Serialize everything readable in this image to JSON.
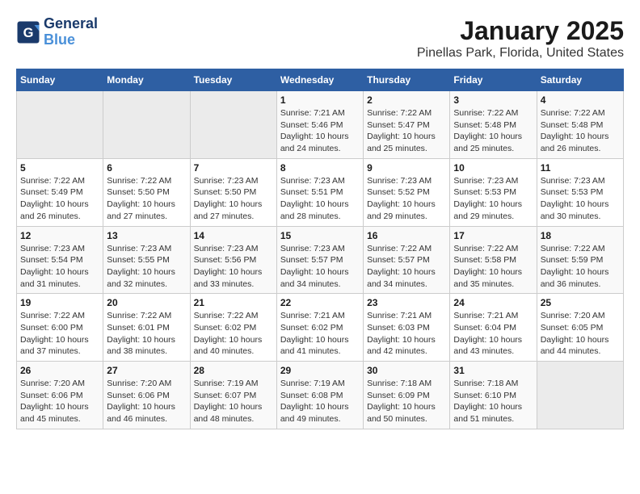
{
  "header": {
    "logo": {
      "general": "General",
      "blue": "Blue"
    },
    "title": "January 2025",
    "subtitle": "Pinellas Park, Florida, United States"
  },
  "calendar": {
    "weekdays": [
      "Sunday",
      "Monday",
      "Tuesday",
      "Wednesday",
      "Thursday",
      "Friday",
      "Saturday"
    ],
    "weeks": [
      [
        {
          "day": "",
          "info": ""
        },
        {
          "day": "",
          "info": ""
        },
        {
          "day": "",
          "info": ""
        },
        {
          "day": "1",
          "info": "Sunrise: 7:21 AM\nSunset: 5:46 PM\nDaylight: 10 hours\nand 24 minutes."
        },
        {
          "day": "2",
          "info": "Sunrise: 7:22 AM\nSunset: 5:47 PM\nDaylight: 10 hours\nand 25 minutes."
        },
        {
          "day": "3",
          "info": "Sunrise: 7:22 AM\nSunset: 5:48 PM\nDaylight: 10 hours\nand 25 minutes."
        },
        {
          "day": "4",
          "info": "Sunrise: 7:22 AM\nSunset: 5:48 PM\nDaylight: 10 hours\nand 26 minutes."
        }
      ],
      [
        {
          "day": "5",
          "info": "Sunrise: 7:22 AM\nSunset: 5:49 PM\nDaylight: 10 hours\nand 26 minutes."
        },
        {
          "day": "6",
          "info": "Sunrise: 7:22 AM\nSunset: 5:50 PM\nDaylight: 10 hours\nand 27 minutes."
        },
        {
          "day": "7",
          "info": "Sunrise: 7:23 AM\nSunset: 5:50 PM\nDaylight: 10 hours\nand 27 minutes."
        },
        {
          "day": "8",
          "info": "Sunrise: 7:23 AM\nSunset: 5:51 PM\nDaylight: 10 hours\nand 28 minutes."
        },
        {
          "day": "9",
          "info": "Sunrise: 7:23 AM\nSunset: 5:52 PM\nDaylight: 10 hours\nand 29 minutes."
        },
        {
          "day": "10",
          "info": "Sunrise: 7:23 AM\nSunset: 5:53 PM\nDaylight: 10 hours\nand 29 minutes."
        },
        {
          "day": "11",
          "info": "Sunrise: 7:23 AM\nSunset: 5:53 PM\nDaylight: 10 hours\nand 30 minutes."
        }
      ],
      [
        {
          "day": "12",
          "info": "Sunrise: 7:23 AM\nSunset: 5:54 PM\nDaylight: 10 hours\nand 31 minutes."
        },
        {
          "day": "13",
          "info": "Sunrise: 7:23 AM\nSunset: 5:55 PM\nDaylight: 10 hours\nand 32 minutes."
        },
        {
          "day": "14",
          "info": "Sunrise: 7:23 AM\nSunset: 5:56 PM\nDaylight: 10 hours\nand 33 minutes."
        },
        {
          "day": "15",
          "info": "Sunrise: 7:23 AM\nSunset: 5:57 PM\nDaylight: 10 hours\nand 34 minutes."
        },
        {
          "day": "16",
          "info": "Sunrise: 7:22 AM\nSunset: 5:57 PM\nDaylight: 10 hours\nand 34 minutes."
        },
        {
          "day": "17",
          "info": "Sunrise: 7:22 AM\nSunset: 5:58 PM\nDaylight: 10 hours\nand 35 minutes."
        },
        {
          "day": "18",
          "info": "Sunrise: 7:22 AM\nSunset: 5:59 PM\nDaylight: 10 hours\nand 36 minutes."
        }
      ],
      [
        {
          "day": "19",
          "info": "Sunrise: 7:22 AM\nSunset: 6:00 PM\nDaylight: 10 hours\nand 37 minutes."
        },
        {
          "day": "20",
          "info": "Sunrise: 7:22 AM\nSunset: 6:01 PM\nDaylight: 10 hours\nand 38 minutes."
        },
        {
          "day": "21",
          "info": "Sunrise: 7:22 AM\nSunset: 6:02 PM\nDaylight: 10 hours\nand 40 minutes."
        },
        {
          "day": "22",
          "info": "Sunrise: 7:21 AM\nSunset: 6:02 PM\nDaylight: 10 hours\nand 41 minutes."
        },
        {
          "day": "23",
          "info": "Sunrise: 7:21 AM\nSunset: 6:03 PM\nDaylight: 10 hours\nand 42 minutes."
        },
        {
          "day": "24",
          "info": "Sunrise: 7:21 AM\nSunset: 6:04 PM\nDaylight: 10 hours\nand 43 minutes."
        },
        {
          "day": "25",
          "info": "Sunrise: 7:20 AM\nSunset: 6:05 PM\nDaylight: 10 hours\nand 44 minutes."
        }
      ],
      [
        {
          "day": "26",
          "info": "Sunrise: 7:20 AM\nSunset: 6:06 PM\nDaylight: 10 hours\nand 45 minutes."
        },
        {
          "day": "27",
          "info": "Sunrise: 7:20 AM\nSunset: 6:06 PM\nDaylight: 10 hours\nand 46 minutes."
        },
        {
          "day": "28",
          "info": "Sunrise: 7:19 AM\nSunset: 6:07 PM\nDaylight: 10 hours\nand 48 minutes."
        },
        {
          "day": "29",
          "info": "Sunrise: 7:19 AM\nSunset: 6:08 PM\nDaylight: 10 hours\nand 49 minutes."
        },
        {
          "day": "30",
          "info": "Sunrise: 7:18 AM\nSunset: 6:09 PM\nDaylight: 10 hours\nand 50 minutes."
        },
        {
          "day": "31",
          "info": "Sunrise: 7:18 AM\nSunset: 6:10 PM\nDaylight: 10 hours\nand 51 minutes."
        },
        {
          "day": "",
          "info": ""
        }
      ]
    ]
  }
}
